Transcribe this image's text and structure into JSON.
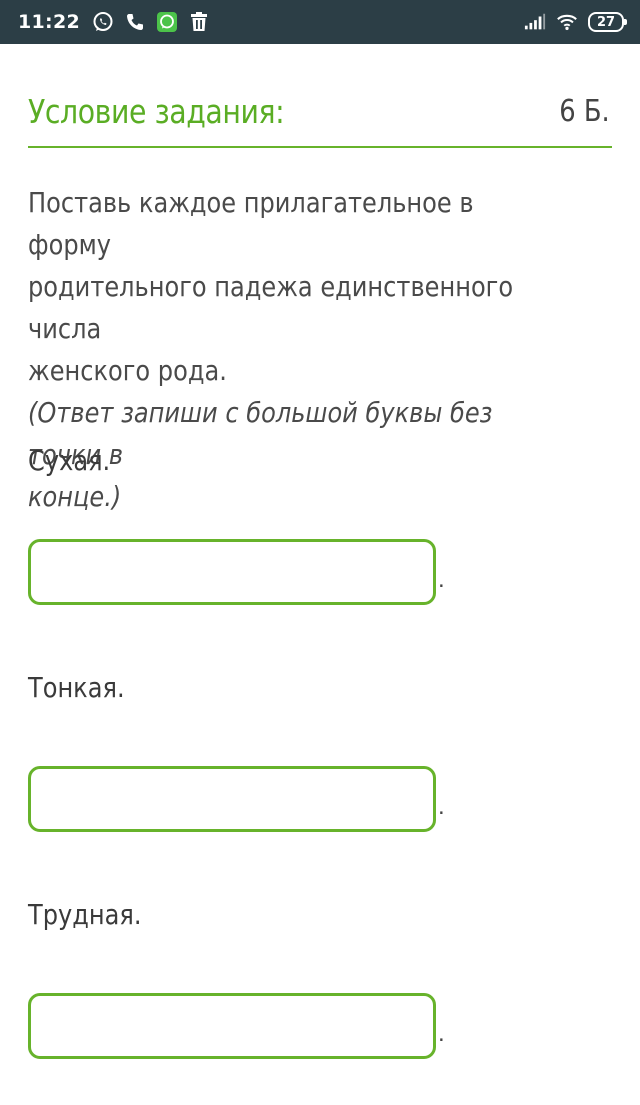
{
  "status_bar": {
    "time": "11:22",
    "icons_left": [
      "whatsapp-icon",
      "phone-icon",
      "whatsapp-business-icon",
      "trash-icon"
    ],
    "icons_right": [
      "signal-icon",
      "wifi-icon"
    ],
    "battery": "27"
  },
  "header": {
    "title": "Условие задания:",
    "points": "6 Б."
  },
  "task": {
    "instruction": "Поставь каждое прилагательное в форму\nродительного падежа единственного числа\nженского рода.",
    "note": "(Ответ запиши с большой буквы без точки в\nконце.)"
  },
  "questions": [
    {
      "label": "Сухая.",
      "answer": "",
      "suffix": "."
    },
    {
      "label": "Тонкая.",
      "answer": "",
      "suffix": "."
    },
    {
      "label": "Трудная.",
      "answer": "",
      "suffix": "."
    }
  ],
  "colors": {
    "accent": "#5aad24",
    "status_bar": "#2c3e46"
  }
}
